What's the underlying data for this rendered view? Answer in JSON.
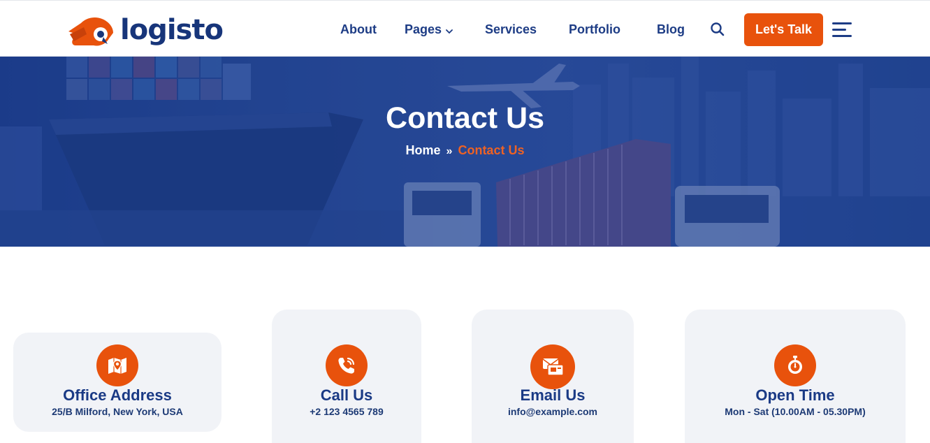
{
  "brand": {
    "name": "logisto",
    "accent": "#e8520c",
    "primary": "#1d3c85"
  },
  "nav": {
    "items": [
      {
        "label": "About"
      },
      {
        "label": "Pages",
        "icon": "chevron-down-icon"
      },
      {
        "label": "Services"
      },
      {
        "label": "Portfolio"
      },
      {
        "label": "Blog"
      }
    ],
    "search_icon": "search-icon",
    "cta_label": "Let's Talk",
    "menu_icon": "hamburger-menu-icon"
  },
  "hero": {
    "title": "Contact Us",
    "breadcrumb": {
      "home": "Home",
      "separator": "»",
      "current": "Contact Us"
    }
  },
  "contact_cards": [
    {
      "title": "Office Address",
      "subtitle": "25/B Milford, New York, USA",
      "icon": "map-pin-icon"
    },
    {
      "title": "Call Us",
      "subtitle": "+2 123 4565 789",
      "icon": "phone-call-icon"
    },
    {
      "title": "Email Us",
      "subtitle": "info@example.com",
      "icon": "envelope-icon"
    },
    {
      "title": "Open Time",
      "subtitle": "Mon - Sat (10.00AM - 05.30PM)",
      "icon": "stopwatch-icon"
    }
  ]
}
